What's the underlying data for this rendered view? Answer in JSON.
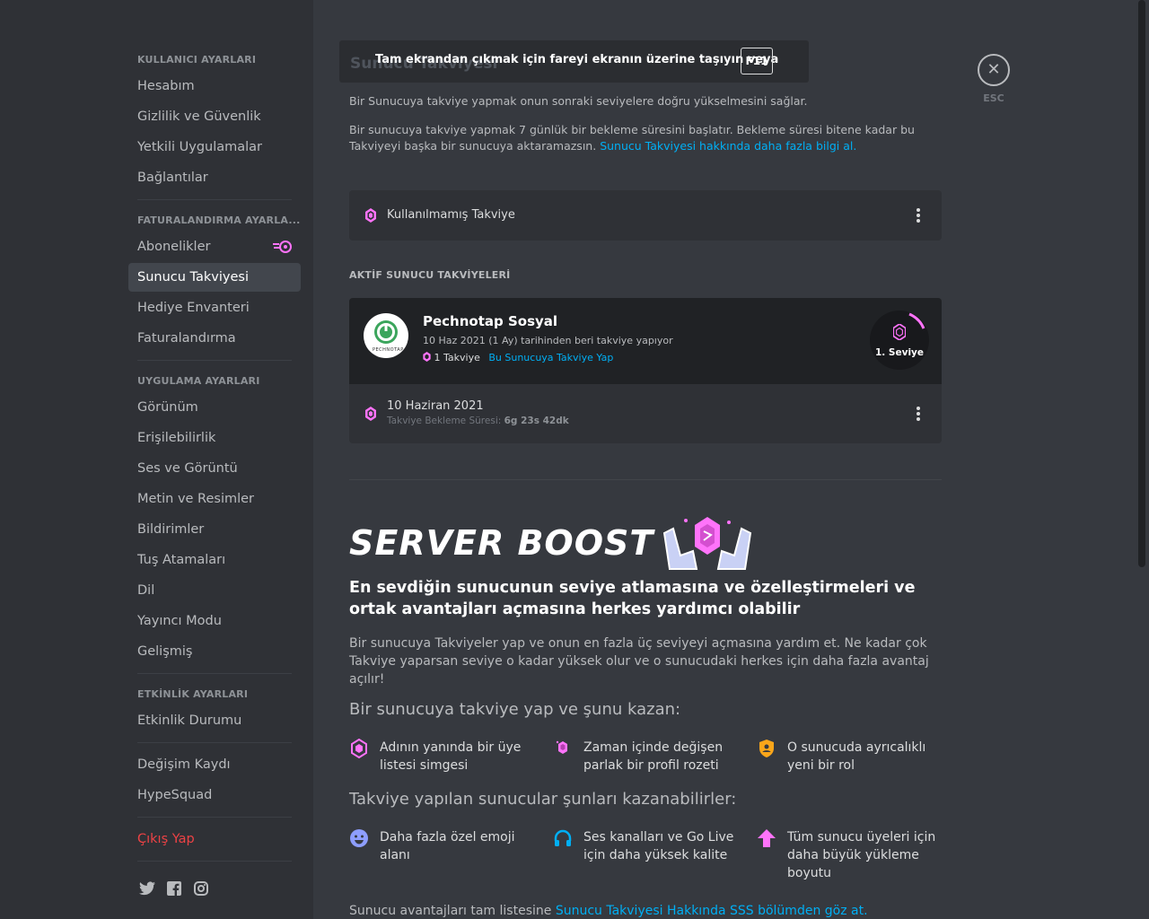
{
  "sidebar": {
    "user_settings_header": "KULLANICI AYARLARI",
    "user_items": [
      "Hesabım",
      "Gizlilik ve Güvenlik",
      "Yetkili Uygulamalar",
      "Bağlantılar"
    ],
    "billing_header": "FATURALANDIRMA AYARLA...",
    "billing_items": [
      "Abonelikler",
      "Sunucu Takviyesi",
      "Hediye Envanteri",
      "Faturalandırma"
    ],
    "app_header": "UYGULAMA AYARLARI",
    "app_items": [
      "Görünüm",
      "Erişilebilirlik",
      "Ses ve Görüntü",
      "Metin ve Resimler",
      "Bildirimler",
      "Tuş Atamaları",
      "Dil",
      "Yayıncı Modu",
      "Gelişmiş"
    ],
    "activity_header": "ETKİNLİK AYARLARI",
    "activity_items": [
      "Etkinlik Durumu"
    ],
    "changelog": "Değişim Kaydı",
    "hypesquad": "HypeSquad",
    "logout": "Çıkış Yap",
    "active_item": "Sunucu Takviyesi"
  },
  "toast": {
    "text": "Tam ekrandan çıkmak için fareyi ekranın üzerine taşıyın veya",
    "key": "F11",
    "ghost_title": "Sunucu Takviyesi"
  },
  "close": {
    "esc_label": "ESC"
  },
  "intro": {
    "p1": "Bir Sunucuya takviye yapmak onun sonraki seviyelere doğru yükselmesini sağlar.",
    "p2": "Bir sunucuya takviye yapmak 7 günlük bir bekleme süresini başlatır. Bekleme süresi bitene kadar bu Takviyeyi başka bir sunucuya aktaramazsın.",
    "p2_link": "Sunucu Takviyesi hakkında daha fazla bilgi al."
  },
  "unused": {
    "label": "Kullanılmamış Takviye"
  },
  "active": {
    "header": "AKTİF SUNUCU TAKVİYELERİ",
    "server_name": "Pechnotap Sosyal",
    "since": "10 Haz 2021 (1 Ay) tarihinden beri takviye yapıyor",
    "boost_count": "1 Takviye",
    "boost_link": "Bu Sunucuya Takviye Yap",
    "level": "1. Seviye",
    "icon_text": "PECHNOTAP",
    "entry_date": "10 Haziran 2021",
    "cooldown_label": "Takviye Bekleme Süresi:",
    "cooldown_value": "6g 23s 42dk"
  },
  "promo": {
    "title": "SERVER BOOST",
    "headline": "En sevdiğin sunucunun seviye atlamasına ve özelleştirmeleri ve ortak avantajları açmasına herkes yardımcı olabilir",
    "desc": "Bir sunucuya Takviyeler yap ve onun en fazla üç seviyeyi açmasına yardım et. Ne kadar çok Takviye yaparsan seviye o kadar yüksek olur ve o sunucudaki herkes için daha fazla avantaj açılır!",
    "get_header": "Bir sunucuya takviye yap ve şunu kazan:",
    "get_perks": [
      "Adının yanında bir üye listesi simgesi",
      "Zaman içinde değişen parlak bir profil rozeti",
      "O sunucuda ayrıcalıklı yeni bir rol"
    ],
    "server_header": "Takviye yapılan sunucular şunları kazanabilirler:",
    "server_perks": [
      "Daha fazla özel emoji alanı",
      "Ses kanalları ve Go Live için daha yüksek kalite",
      "Tüm sunucu üyeleri için daha büyük yükleme boyutu"
    ],
    "footer_text": "Sunucu avantajları tam listesine",
    "footer_link": "Sunucu Takviyesi Hakkında SSS bölümden göz at."
  },
  "colors": {
    "accent_pink": "#ff73fa",
    "link": "#00aff4",
    "danger": "#ed4245",
    "gold": "#faa61a",
    "blurple": "#5865f2"
  }
}
